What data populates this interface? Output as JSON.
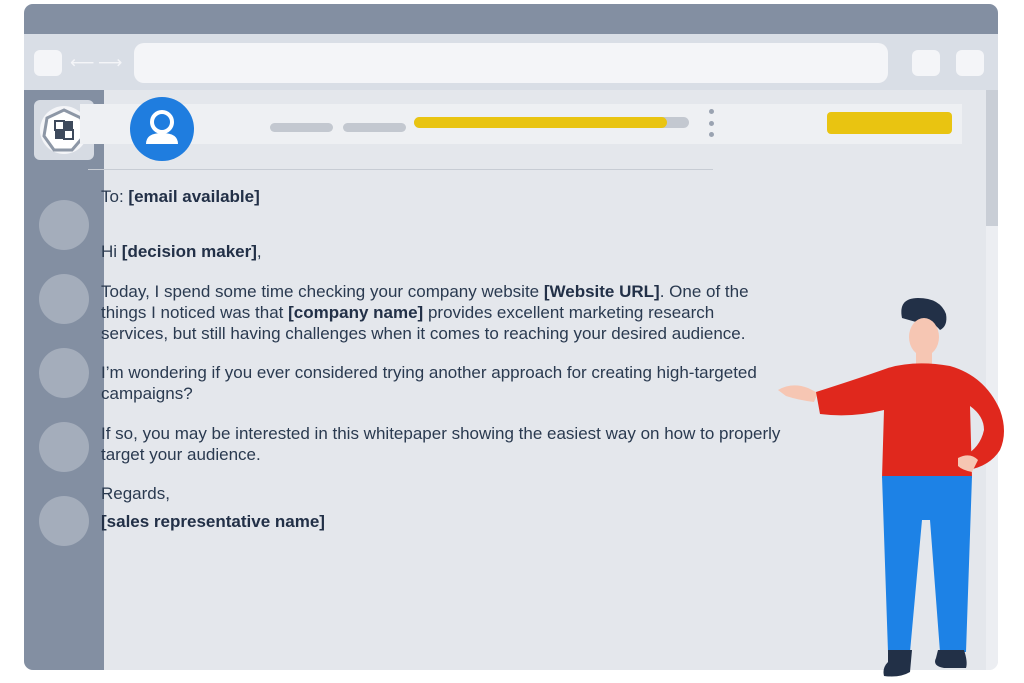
{
  "email": {
    "to_label": "To:",
    "to_value": "[email available]",
    "greeting_prefix": "Hi",
    "greeting_name": "[decision maker]",
    "greeting_suffix": ",",
    "p1_part1": "Today, I spend some time checking your company website",
    "p1_url": "[Website URL]",
    "p1_part2": "One of the things I noticed was that",
    "p1_company": "[company name]",
    "p1_part3": "provides excellent marketing research services, but still having challenges when it comes to reaching your desired audience.",
    "p2": "I’m wondering if you ever considered trying another approach for creating high-targeted campaigns?",
    "p3": "If so, you may be interested in this whitepaper showing the easiest way on how to properly target your audience.",
    "signoff": "Regards,",
    "signature": "[sales representative name]"
  },
  "toolbar": {
    "back_arrow": "⟵",
    "forward_arrow": "⟶"
  },
  "message_header": {
    "progress": 0.92
  },
  "icons": {
    "avatar": "user-avatar-icon",
    "logo": "app-logo-icon",
    "menu": "kebab-menu-icon"
  },
  "colors": {
    "accent_yellow": "#e9c411",
    "avatar_blue": "#1f7ddf",
    "chrome_gray": "#838fa2",
    "text_dark": "#2a3a50",
    "person_shirt": "#e0281d",
    "person_pants": "#1d82e6"
  }
}
